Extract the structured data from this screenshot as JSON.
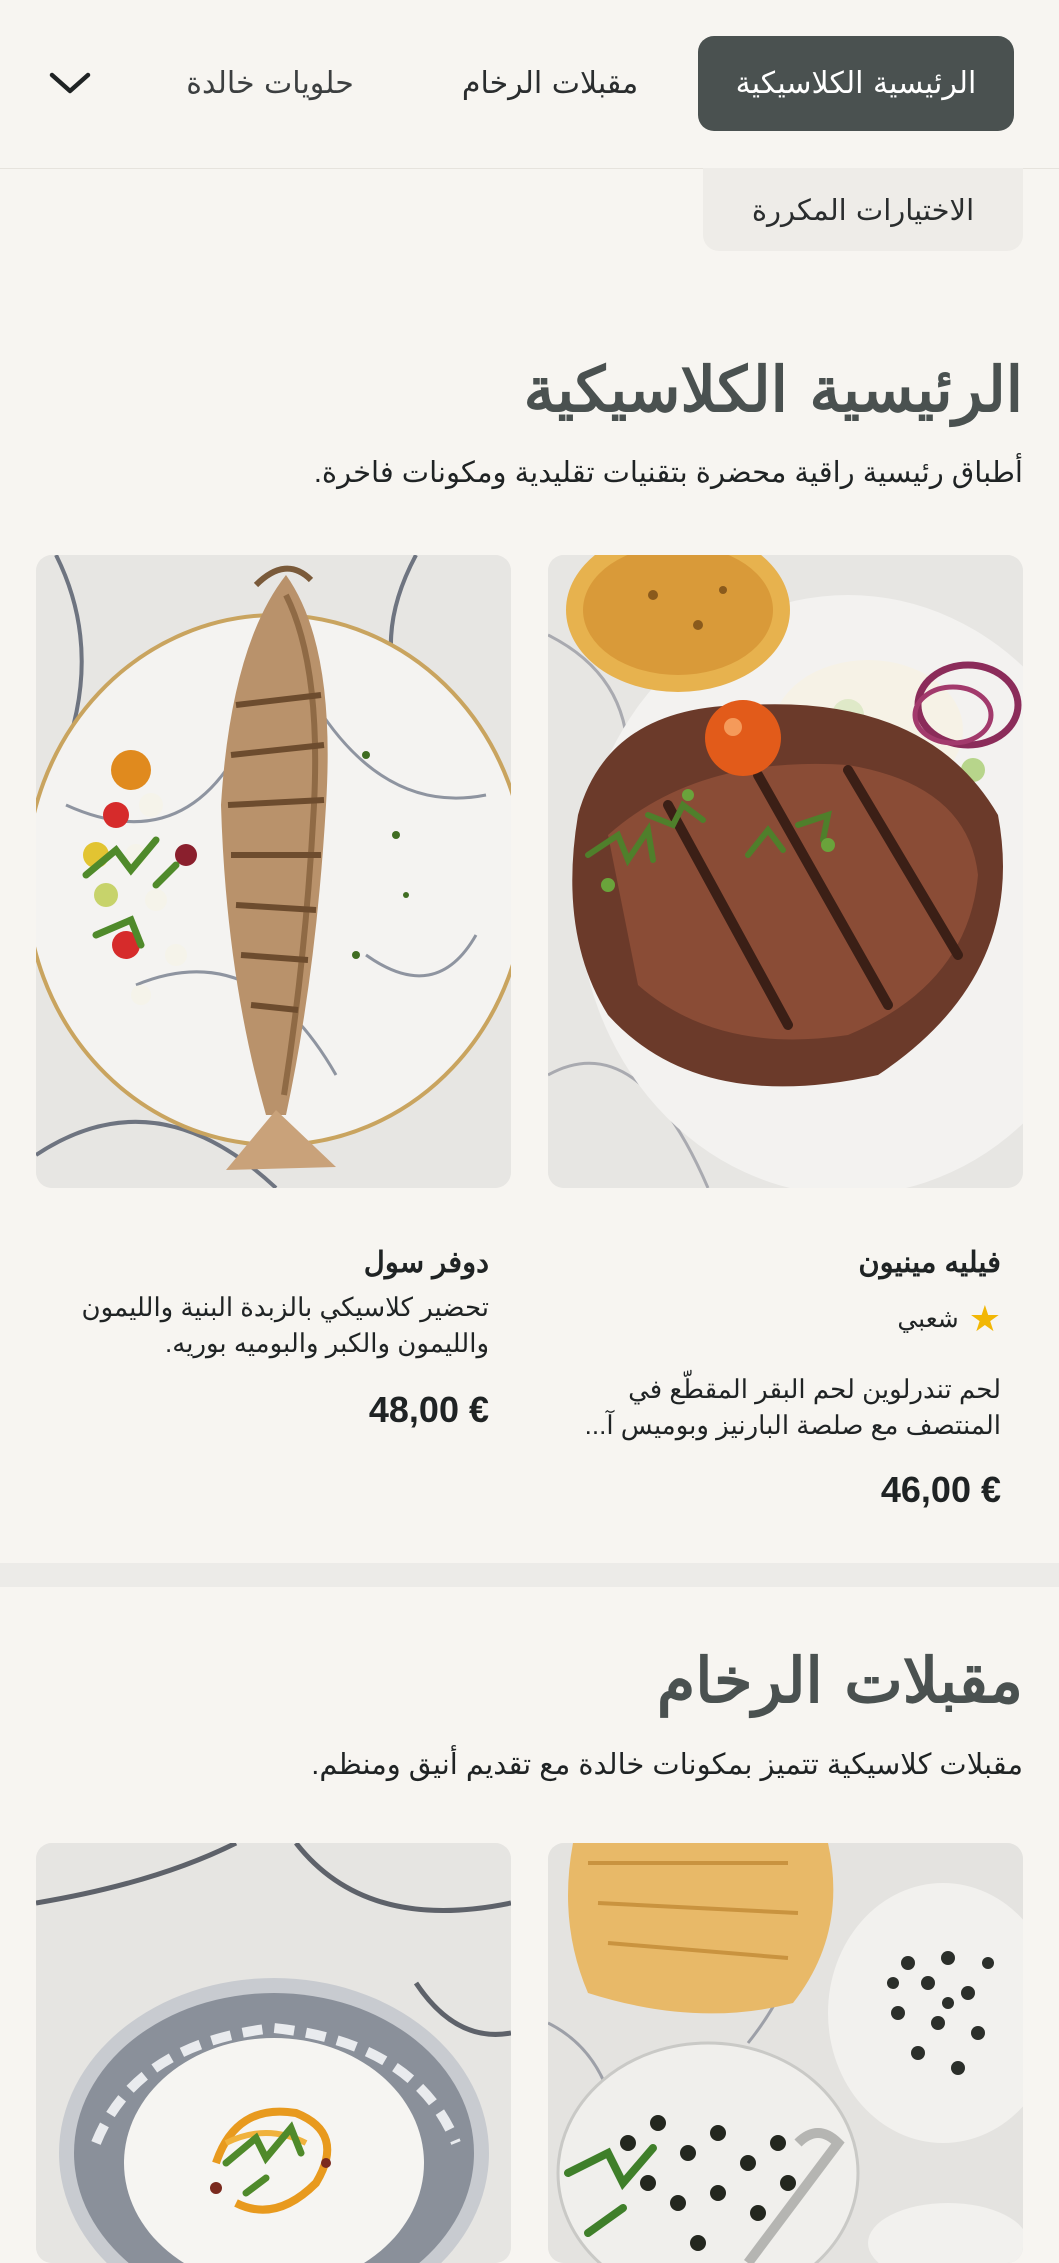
{
  "nav": {
    "tabs": [
      {
        "label": "الرئيسية الكلاسيكية",
        "active": true
      },
      {
        "label": "مقبلات الرخام",
        "active": false
      },
      {
        "label": "حلويات خالدة",
        "active": false
      }
    ],
    "more_tab": {
      "label": "الاختيارات المكررة"
    },
    "expand_icon": "chevron-down-icon",
    "active_color": "#4a5150"
  },
  "sections": [
    {
      "title": "الرئيسية الكلاسيكية",
      "subtitle": "أطباق رئيسية راقية محضرة بتقنيات تقليدية ومكونات فاخرة.",
      "items": [
        {
          "name": "فيليه مينيون",
          "badge": "شعبي",
          "badge_icon": "star-icon",
          "description_line1": "لحم تندرلوين لحم البقر المقطّع في",
          "description_line2": "المنتصف مع صلصة البارنيز وبوميس آ...",
          "price": "46,00 €"
        },
        {
          "name": "دوفر سول",
          "description_line1": "تحضير كلاسيكي بالزبدة البنية والليمون",
          "description_line2": "والليمون والكبر والبوميه بوريه.",
          "price": "48,00 €"
        }
      ]
    },
    {
      "title": "مقبلات الرخام",
      "subtitle": "مقبلات كلاسيكية تتميز بمكونات خالدة مع تقديم أنيق ومنظم."
    }
  ],
  "colors": {
    "background": "#f7f5f1",
    "accent": "#4a5150",
    "star": "#f2b705"
  }
}
